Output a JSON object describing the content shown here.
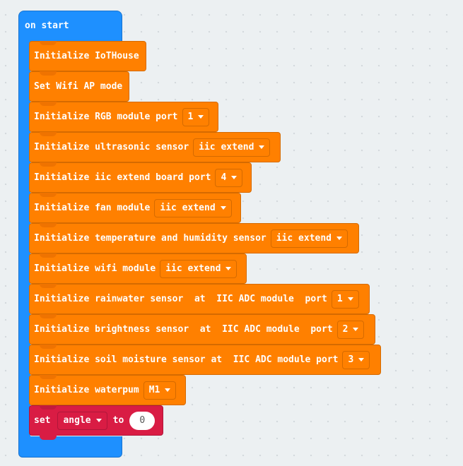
{
  "event": {
    "label": "on start"
  },
  "blocks": [
    {
      "text": "Initialize IoTHouse"
    },
    {
      "text": "Set Wifi AP mode"
    },
    {
      "text": "Initialize RGB module port",
      "dropdown": "1"
    },
    {
      "text": "Initialize ultrasonic sensor",
      "dropdown": "iic extend"
    },
    {
      "text": "Initialize iic extend board port",
      "dropdown": "4"
    },
    {
      "text": "Initialize fan module",
      "dropdown": "iic extend"
    },
    {
      "text": "Initialize temperature and humidity sensor",
      "dropdown": "iic extend"
    },
    {
      "text": "Initialize wifi module",
      "dropdown": "iic extend"
    },
    {
      "text": "Initialize rainwater sensor  at  IIC ADC module  port",
      "dropdown": "1"
    },
    {
      "text": "Initialize brightness sensor  at  IIC ADC module  port",
      "dropdown": "2"
    },
    {
      "text": "Initialize soil moisture sensor at  IIC ADC module port",
      "dropdown": "3"
    },
    {
      "text": "Initialize waterpum",
      "dropdown": "M1"
    }
  ],
  "set_block": {
    "set_label": "set",
    "variable": "angle",
    "to_label": "to",
    "value": "0"
  },
  "colors": {
    "event": "#1e90ff",
    "block": "#ff8000",
    "variable": "#d91c44"
  },
  "icons": {
    "dropdown": "caret-down-icon"
  }
}
